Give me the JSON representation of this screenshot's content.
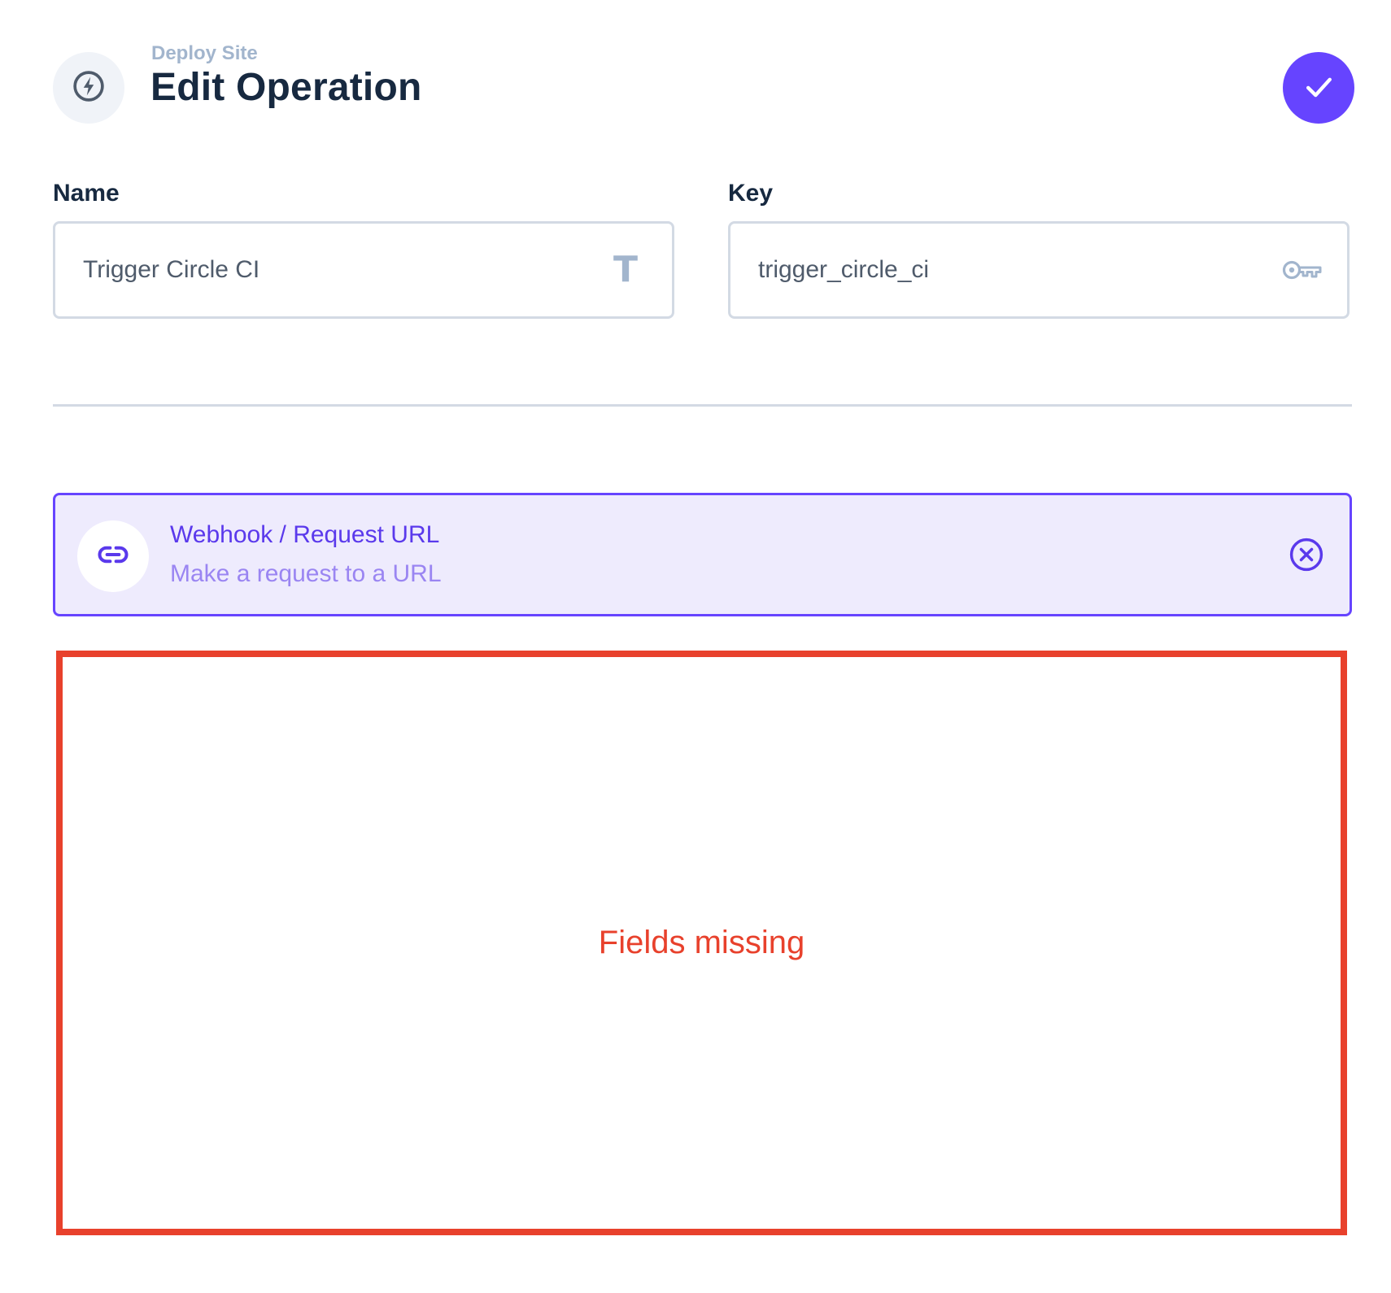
{
  "header": {
    "breadcrumb": "Deploy Site",
    "title": "Edit Operation",
    "icon": "bolt-icon",
    "save_icon": "check-icon"
  },
  "fields": {
    "name": {
      "label": "Name",
      "value": "Trigger Circle CI",
      "icon": "text-type-icon",
      "icon_glyph": "T"
    },
    "key": {
      "label": "Key",
      "value": "trigger_circle_ci",
      "icon": "key-icon"
    }
  },
  "operation": {
    "title": "Webhook / Request URL",
    "subtitle": "Make a request to a URL",
    "icon": "link-icon",
    "remove_icon": "close-circle-icon"
  },
  "missing": {
    "text": "Fields missing"
  },
  "colors": {
    "accent": "#6644ff",
    "accent_text": "#5a39ec",
    "accent_soft": "#eeebfd",
    "muted": "#a2b5cd",
    "error": "#e8412c"
  }
}
